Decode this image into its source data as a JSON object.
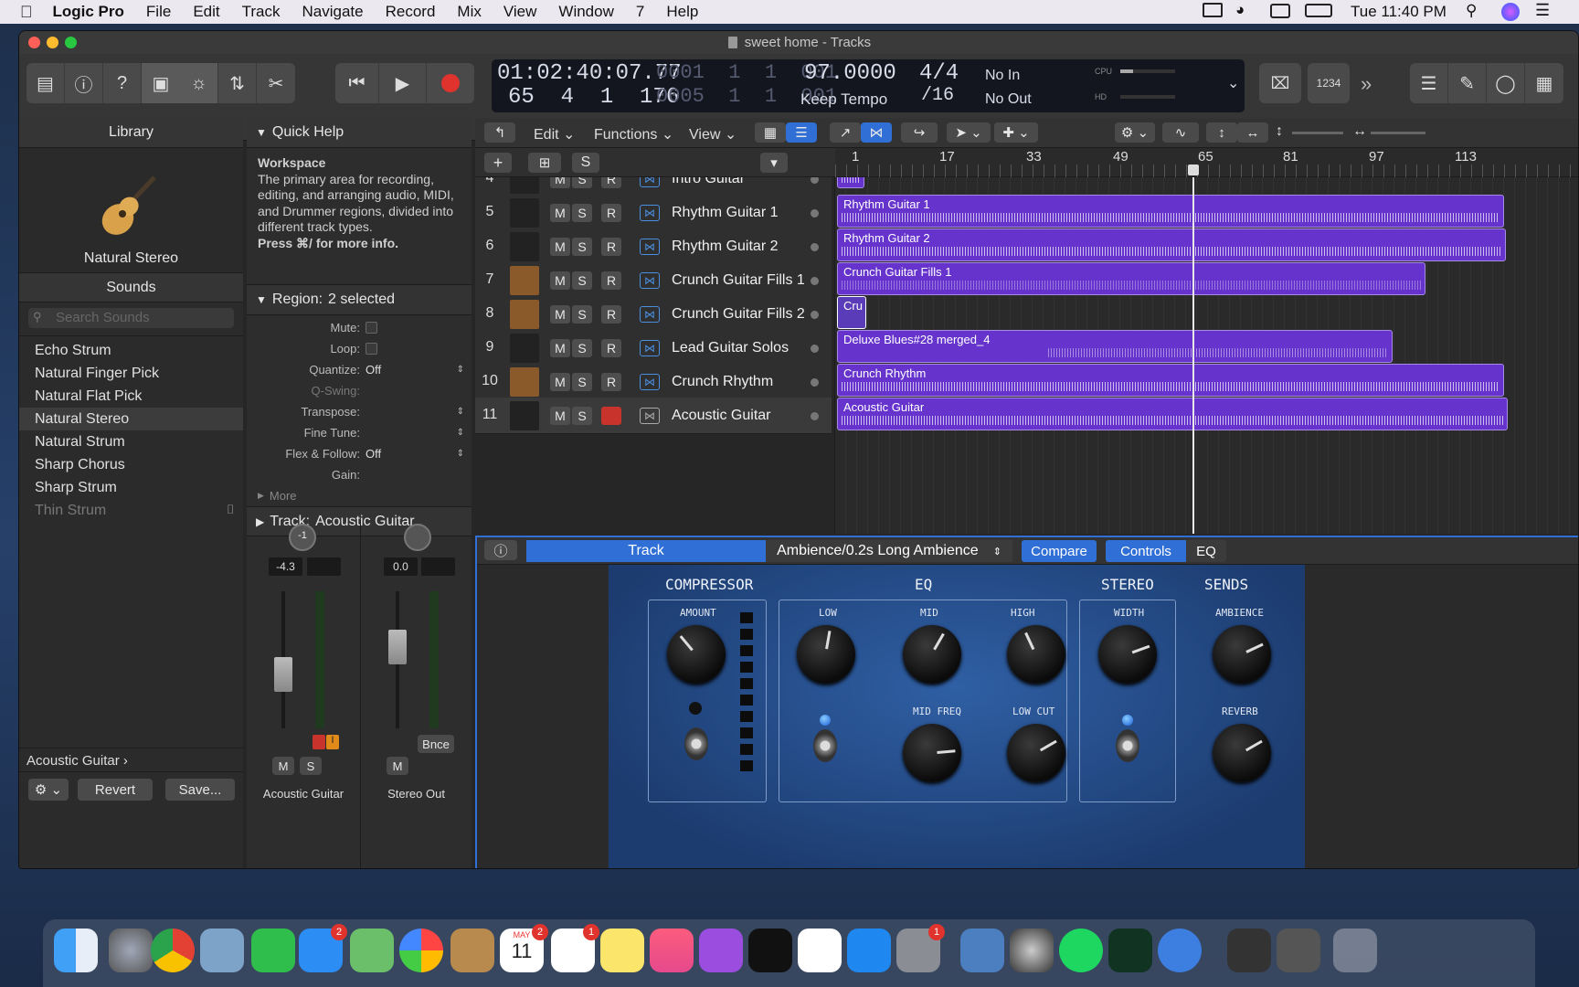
{
  "menubar": {
    "app": "Logic Pro",
    "items": [
      "File",
      "Edit",
      "Track",
      "Navigate",
      "Record",
      "Mix",
      "View",
      "Window",
      "7",
      "Help"
    ],
    "clock": "Tue 11:40 PM"
  },
  "window": {
    "title": "sweet home - Tracks"
  },
  "lcd": {
    "time": "01:02:40:07.77",
    "bars": "65  4  1  176",
    "pos1_dim": "0001  1  1  001",
    "pos2_dim": "0005  1  1  001",
    "tempo": "97.0000",
    "tempo_mode": "Keep Tempo",
    "sig": "4/4",
    "div": "/16",
    "in": "No In",
    "out": "No Out",
    "cpu": "CPU",
    "hd": "HD"
  },
  "toolbar": {
    "counter": "1234"
  },
  "library": {
    "title": "Library",
    "patch": "Natural Stereo",
    "sounds_title": "Sounds",
    "search_placeholder": "Search Sounds",
    "items": [
      "Echo Strum",
      "Natural Finger Pick",
      "Natural Flat Pick",
      "Natural Stereo",
      "Natural Strum",
      "Sharp Chorus",
      "Sharp Strum",
      "Thin Strum"
    ],
    "footer": "Acoustic Guitar ›",
    "revert": "Revert",
    "save": "Save..."
  },
  "quickhelp": {
    "title": "Quick Help",
    "heading": "Workspace",
    "body": "The primary area for recording, editing, and arranging audio, MIDI, and Drummer regions, divided into different track types.",
    "more": "Press ⌘/ for more info."
  },
  "region_inspector": {
    "title": "Region:",
    "value": "2 selected",
    "rows": [
      {
        "label": "Mute:",
        "value": ""
      },
      {
        "label": "Loop:",
        "value": ""
      },
      {
        "label": "Quantize:",
        "value": "Off"
      },
      {
        "label": "Q-Swing:",
        "value": ""
      },
      {
        "label": "Transpose:",
        "value": ""
      },
      {
        "label": "Fine Tune:",
        "value": ""
      },
      {
        "label": "Flex & Follow:",
        "value": "Off"
      },
      {
        "label": "Gain:",
        "value": ""
      }
    ],
    "more": "More"
  },
  "track_inspector": {
    "title": "Track:",
    "value": "Acoustic Guitar"
  },
  "strips": [
    {
      "pan": "-1",
      "gain": "-4.3",
      "m": "M",
      "s": "S",
      "name": "Acoustic Guitar"
    },
    {
      "pan": "",
      "gain": "0.0",
      "bnce": "Bnce",
      "m": "M",
      "name": "Stereo Out"
    }
  ],
  "scale": [
    "0",
    "3",
    "6",
    "9",
    "12",
    "15",
    "18",
    "21",
    "24",
    "30",
    "35",
    "40",
    "45",
    "50",
    "60"
  ],
  "tracks_header": {
    "edit": "Edit",
    "functions": "Functions",
    "view": "View",
    "s": "S"
  },
  "ruler": [
    "1",
    "17",
    "33",
    "49",
    "65",
    "81",
    "97",
    "113"
  ],
  "tracks": [
    {
      "num": "4",
      "name": "Intro Guitar"
    },
    {
      "num": "5",
      "name": "Rhythm Guitar 1"
    },
    {
      "num": "6",
      "name": "Rhythm Guitar 2"
    },
    {
      "num": "7",
      "name": "Crunch Guitar Fills 1"
    },
    {
      "num": "8",
      "name": "Crunch Guitar Fills 2"
    },
    {
      "num": "9",
      "name": "Lead Guitar Solos"
    },
    {
      "num": "10",
      "name": "Crunch Rhythm"
    },
    {
      "num": "11",
      "name": "Acoustic Guitar"
    }
  ],
  "regions": [
    "Rhythm Guitar 1",
    "Rhythm Guitar 2",
    "Crunch Guitar Fills 1",
    "Cru",
    "Deluxe Blues#28 merged_4",
    "Crunch Rhythm",
    "Acoustic Guitar"
  ],
  "plugin": {
    "tab_track": "Track",
    "preset": "Ambience/0.2s Long Ambience",
    "compare": "Compare",
    "controls": "Controls",
    "eq": "EQ",
    "sections": {
      "compressor": "COMPRESSOR",
      "eq": "EQ",
      "stereo": "STEREO",
      "sends": "SENDS"
    },
    "labels": {
      "amount": "AMOUNT",
      "low": "LOW",
      "mid": "MID",
      "high": "HIGH",
      "mid_freq": "MID FREQ",
      "low_cut": "LOW CUT",
      "width": "WIDTH",
      "ambience": "AMBIENCE",
      "reverb": "REVERB"
    }
  },
  "dock": {
    "badges": {
      "messages": "2",
      "calendar": "2",
      "reminders": "1",
      "prefs": "1"
    },
    "cal_month": "MAY",
    "cal_day": "11"
  },
  "colors": {
    "region": "#6633cc",
    "accent": "#2f6fd6",
    "record": "#e0332d"
  }
}
